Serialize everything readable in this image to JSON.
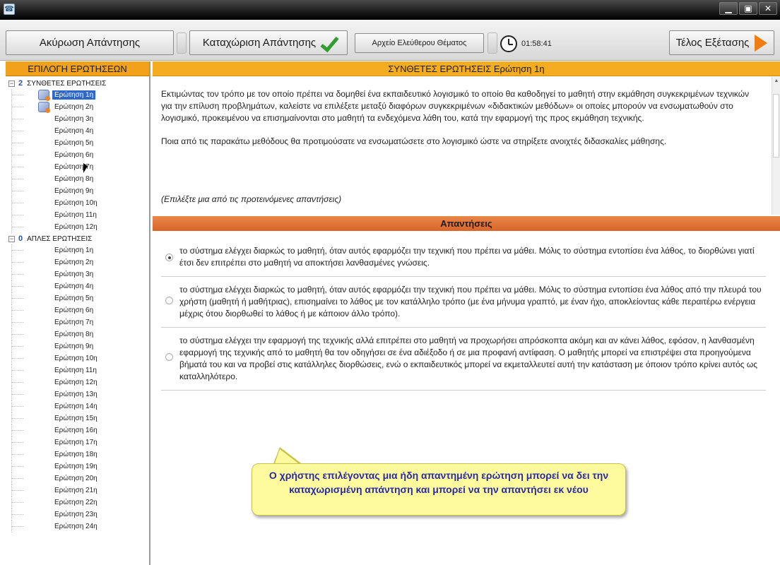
{
  "window": {
    "icon": "app-icon",
    "controls": [
      "minimize",
      "restore",
      "close"
    ],
    "control_glyphs": [
      "▁",
      "▣",
      "✕"
    ]
  },
  "toolbar": {
    "cancel_label": "Ακύρωση Απάντησης",
    "submit_label": "Καταχώριση Απάντησης",
    "file_label": "Αρχείο Ελεύθερου Θέματος",
    "timer": "01:58:41",
    "end_label": "Τέλος Εξέτασης"
  },
  "sidebar": {
    "title": "ΕΠΙΛΟΓΗ ΕΡΩΤΗΣΕΩΝ",
    "groups": [
      {
        "count": "2",
        "label": "ΣΥΝΘΕΤΕΣ ΕΡΩΤΗΣΕΙΣ",
        "items": [
          "Ερώτηση 1η",
          "Ερώτηση 2η",
          "Ερώτηση 3η",
          "Ερώτηση 4η",
          "Ερώτηση 5η",
          "Ερώτηση 6η",
          "Ερώτηση 7η",
          "Ερώτηση 8η",
          "Ερώτηση 9η",
          "Ερώτηση 10η",
          "Ερώτηση 11η",
          "Ερώτηση 12η"
        ]
      },
      {
        "count": "0",
        "label": "ΑΠΛΕΣ ΕΡΩΤΗΣΕΙΣ",
        "items": [
          "Ερώτηση 1η",
          "Ερώτηση 2η",
          "Ερώτηση 3η",
          "Ερώτηση 4η",
          "Ερώτηση 5η",
          "Ερώτηση 6η",
          "Ερώτηση 7η",
          "Ερώτηση 8η",
          "Ερώτηση 9η",
          "Ερώτηση 10η",
          "Ερώτηση 11η",
          "Ερώτηση 12η",
          "Ερώτηση 13η",
          "Ερώτηση 14η",
          "Ερώτηση 15η",
          "Ερώτηση 16η",
          "Ερώτηση 17η",
          "Ερώτηση 18η",
          "Ερώτηση 19η",
          "Ερώτηση 20η",
          "Ερώτηση 21η",
          "Ερώτηση 22η",
          "Ερώτηση 23η",
          "Ερώτηση 24η"
        ]
      }
    ]
  },
  "question": {
    "header": "ΣΥΝΘΕΤΕΣ ΕΡΩΤΗΣΕΙΣ Ερώτηση 1η",
    "paragraph1": "Εκτιμώντας τον τρόπο με τον οποίο πρέπει να δομηθεί ένα εκπαιδευτικό λογισμικό το οποίο θα καθοδηγεί το μαθητή στην εκμάθηση συγκεκριμένων τεχνικών για την επίλυση προβλημάτων, καλείστε να επιλέξετε μεταξύ διαφόρων συγκεκριμένων «διδακτικών μεθόδων» οι οποίες μπορούν να ενσωματωθούν στο λογισμικό, προκειμένου να επισημαίνονται στο μαθητή τα ενδεχόμενα λάθη του, κατά την εφαρμογή της προς εκμάθηση τεχνικής.",
    "paragraph2": "Ποια από τις παρακάτω μεθόδους θα προτιμούσατε να ενσωματώσετε στο λογισμικό ώστε να στηρίξετε ανοιχτές διδασκαλίες μάθησης.",
    "instruction": "(Επιλέξτε μια από τις προτεινόμενες απαντήσεις)"
  },
  "answers": {
    "header": "Απαντήσεις",
    "options": [
      "το σύστημα ελέγχει διαρκώς το μαθητή, όταν αυτός εφαρμόζει την τεχνική που πρέπει να μάθει. Μόλις το σύστημα εντοπίσει ένα λάθος, το διορθώνει γιατί έτσι δεν επιτρέπει στο μαθητή να αποκτήσει λανθασμένες γνώσεις.",
      "το σύστημα ελέγχει διαρκώς το μαθητή, όταν αυτός εφαρμόζει την τεχνική που πρέπει να μάθει. Μόλις το σύστημα εντοπίσει ένα λάθος από την πλευρά του χρήστη (μαθητή ή μαθήτριας), επισημαίνει το λάθος με τον κατάλληλο τρόπο (με ένα μήνυμα γραπτό, με έναν ήχο, αποκλείοντας κάθε περαιτέρω ενέργεια μέχρις ότου διορθωθεί το λάθος ή με κάποιον άλλο τρόπο).",
      "το σύστημα ελέγχει την εφαρμογή της τεχνικής αλλά επιτρέπει στο μαθητή να προχωρήσει απρόσκοπτα ακόμη και αν κάνει λάθος, εφόσον, η λανθασμένη εφαρμογή της τεχνικής από το μαθητή θα τον οδηγήσει σε ένα αδιέξοδο ή σε μια προφανή αντίφαση. Ο μαθητής μπορεί να επιστρέψει στα προηγούμενα βήματά του και να προβεί στις κατάλληλες διορθώσεις, ενώ ο εκπαιδευτικός μπορεί να εκμεταλλευτεί αυτή την κατάσταση με όποιον τρόπο κρίνει αυτός ως καταλληλότερο."
    ],
    "selected_index": 0
  },
  "callout": {
    "text": "Ο χρήστης επιλέγοντας μια ήδη απαντημένη ερώτηση μπορεί να δει την καταχωρισμένη απάντηση και μπορεί να την απαντήσει εκ νέου"
  }
}
